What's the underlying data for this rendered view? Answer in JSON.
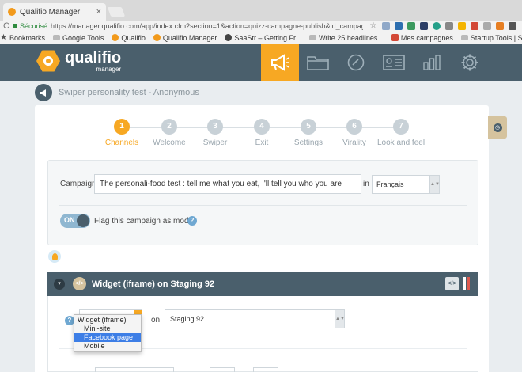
{
  "browser": {
    "tab_title": "Qualifio Manager",
    "tab_close": "×",
    "back": "←",
    "forward": "→",
    "reload": "C",
    "secure_label": "Sécurisé",
    "url": "https://manager.qualifio.com/app/index.cfm?section=1&action=quizz-campagne-publish&id_campagne=...",
    "bookmark_star": "☆",
    "bookmarks": [
      {
        "label": "Bookmarks",
        "icon": "star-icon"
      },
      {
        "label": "Google Tools",
        "icon": "folder-icon"
      },
      {
        "label": "Qualifio",
        "icon": "qualifio-icon"
      },
      {
        "label": "Qualifio Manager",
        "icon": "qualifio-icon"
      },
      {
        "label": "SaaStr – Getting Fr...",
        "icon": "saastr-icon"
      },
      {
        "label": "Write 25 headlines...",
        "icon": "folder-icon"
      },
      {
        "label": "Mes campagnes",
        "icon": "mail-icon"
      },
      {
        "label": "Startup Tools | Stev...",
        "icon": "folder-icon"
      }
    ]
  },
  "app": {
    "logo_name": "qualifio",
    "logo_sub": "manager",
    "nav": [
      {
        "name": "campaigns-megaphone-icon",
        "active": true
      },
      {
        "name": "folder-icon",
        "active": false
      },
      {
        "name": "check-circle-icon",
        "active": false
      },
      {
        "name": "id-card-icon",
        "active": false
      },
      {
        "name": "bar-chart-icon",
        "active": false
      },
      {
        "name": "settings-gear-icon",
        "active": false
      }
    ],
    "accent_color": "#f7a823",
    "header_color": "#4a5f6c"
  },
  "page": {
    "title": "Swiper personality test - Anonymous"
  },
  "steps": [
    {
      "num": "1",
      "label": "Channels",
      "active": true
    },
    {
      "num": "2",
      "label": "Welcome",
      "active": false
    },
    {
      "num": "3",
      "label": "Swiper",
      "active": false
    },
    {
      "num": "4",
      "label": "Exit",
      "active": false
    },
    {
      "num": "5",
      "label": "Settings",
      "active": false
    },
    {
      "num": "6",
      "label": "Virality",
      "active": false
    },
    {
      "num": "7",
      "label": "Look and feel",
      "active": false
    }
  ],
  "campaign": {
    "label": "Campaign",
    "value": "The personali-food test : tell me what you eat, I'll tell you who you are",
    "in_label": "in",
    "language": "Français",
    "toggle_label": "ON",
    "flag_label": "Flag this campaign as model",
    "help": "?"
  },
  "widget": {
    "chevron": "▾",
    "code_icon": "</>",
    "title": "Widget (iframe) on Staging 92",
    "on_label": "on",
    "environment": "Staging 92",
    "dropdown_options": [
      {
        "label": "Widget (iframe)",
        "checked": true,
        "highlighted": false
      },
      {
        "label": "Mini-site",
        "checked": false,
        "highlighted": false
      },
      {
        "label": "Facebook page",
        "checked": false,
        "highlighted": true
      },
      {
        "label": "Mobile",
        "checked": false,
        "highlighted": false
      }
    ]
  }
}
